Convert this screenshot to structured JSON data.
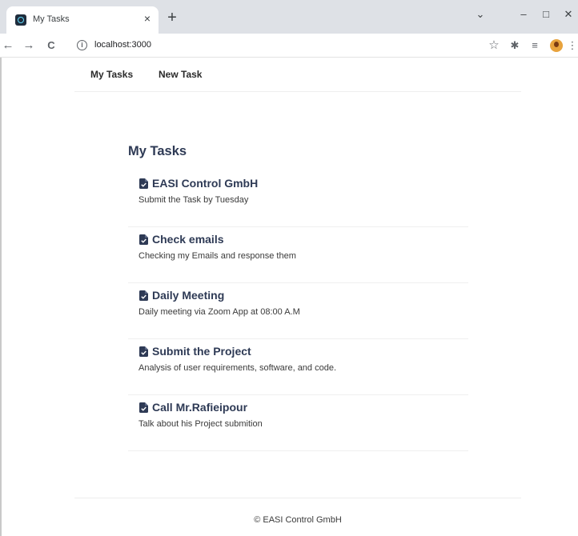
{
  "browser": {
    "tab_title": "My Tasks",
    "tab_close_glyph": "×",
    "new_tab_glyph": "+",
    "url": "localhost:3000",
    "tab_favicon": "react-icon",
    "window_controls": {
      "tab_search": "⌄",
      "minimize": "–",
      "maximize": "□",
      "close": "✕"
    },
    "toolbar_glyphs": {
      "back": "←",
      "forward": "→",
      "reload": "C",
      "info": "i",
      "star": "☆",
      "extensions": "✱",
      "reading_list": "≡",
      "menu": "⋮"
    }
  },
  "nav": {
    "links": [
      "My Tasks",
      "New Task"
    ]
  },
  "main": {
    "heading": "My Tasks",
    "tasks": [
      {
        "title": "EASI Control GmbH",
        "description": "Submit the Task by Tuesday"
      },
      {
        "title": "Check emails",
        "description": "Checking my Emails and response them"
      },
      {
        "title": "Daily Meeting",
        "description": "Daily meeting via Zoom App at 08:00 A.M"
      },
      {
        "title": "Submit the Project",
        "description": "Analysis of user requirements, software, and code."
      },
      {
        "title": "Call Mr.Rafieipour",
        "description": "Talk about his Project submition"
      }
    ]
  },
  "footer": {
    "text": "© EASI Control GmbH"
  },
  "colors": {
    "heading": "#2e3a55",
    "tabstrip": "#dee1e6",
    "divider": "#eeeeee"
  }
}
